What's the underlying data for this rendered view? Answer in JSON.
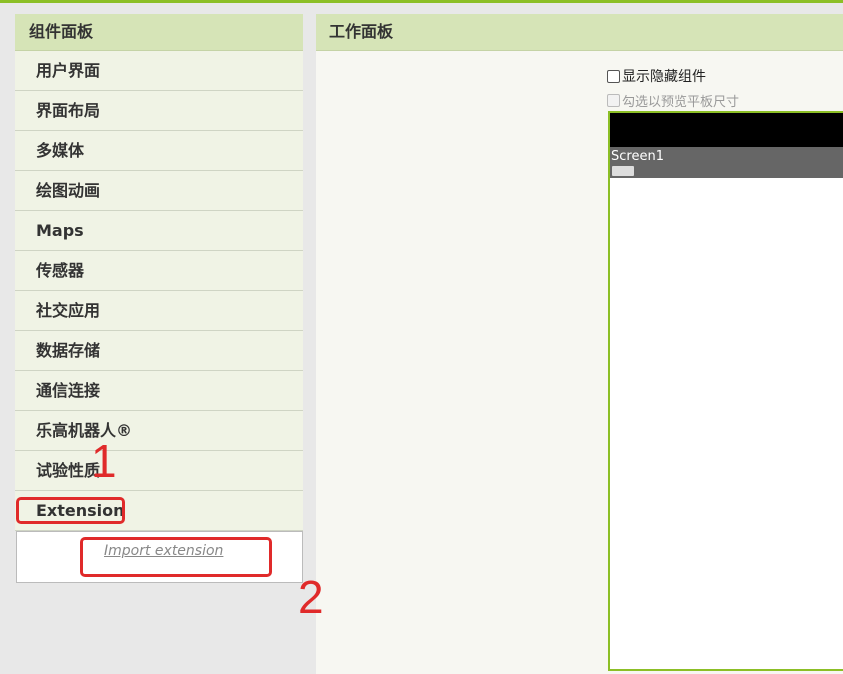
{
  "palette": {
    "title": "组件面板",
    "drawers": [
      {
        "label": "用户界面"
      },
      {
        "label": "界面布局"
      },
      {
        "label": "多媒体"
      },
      {
        "label": "绘图动画"
      },
      {
        "label": "Maps"
      },
      {
        "label": "传感器"
      },
      {
        "label": "社交应用"
      },
      {
        "label": "数据存储"
      },
      {
        "label": "通信连接"
      },
      {
        "label": "乐高机器人®"
      },
      {
        "label": "试验性质"
      },
      {
        "label": "Extension"
      }
    ],
    "import_extension_label": "Import extension"
  },
  "viewer": {
    "title": "工作面板",
    "show_hidden_label": "显示隐藏组件",
    "tablet_preview_label": "勾选以预览平板尺寸",
    "screen_title": "Screen1"
  },
  "annotations": {
    "step1": "1",
    "step2": "2",
    "color": "#e02a2a"
  },
  "colors": {
    "accent_green": "#8cbf26",
    "header_bg": "#d6e4b7"
  }
}
